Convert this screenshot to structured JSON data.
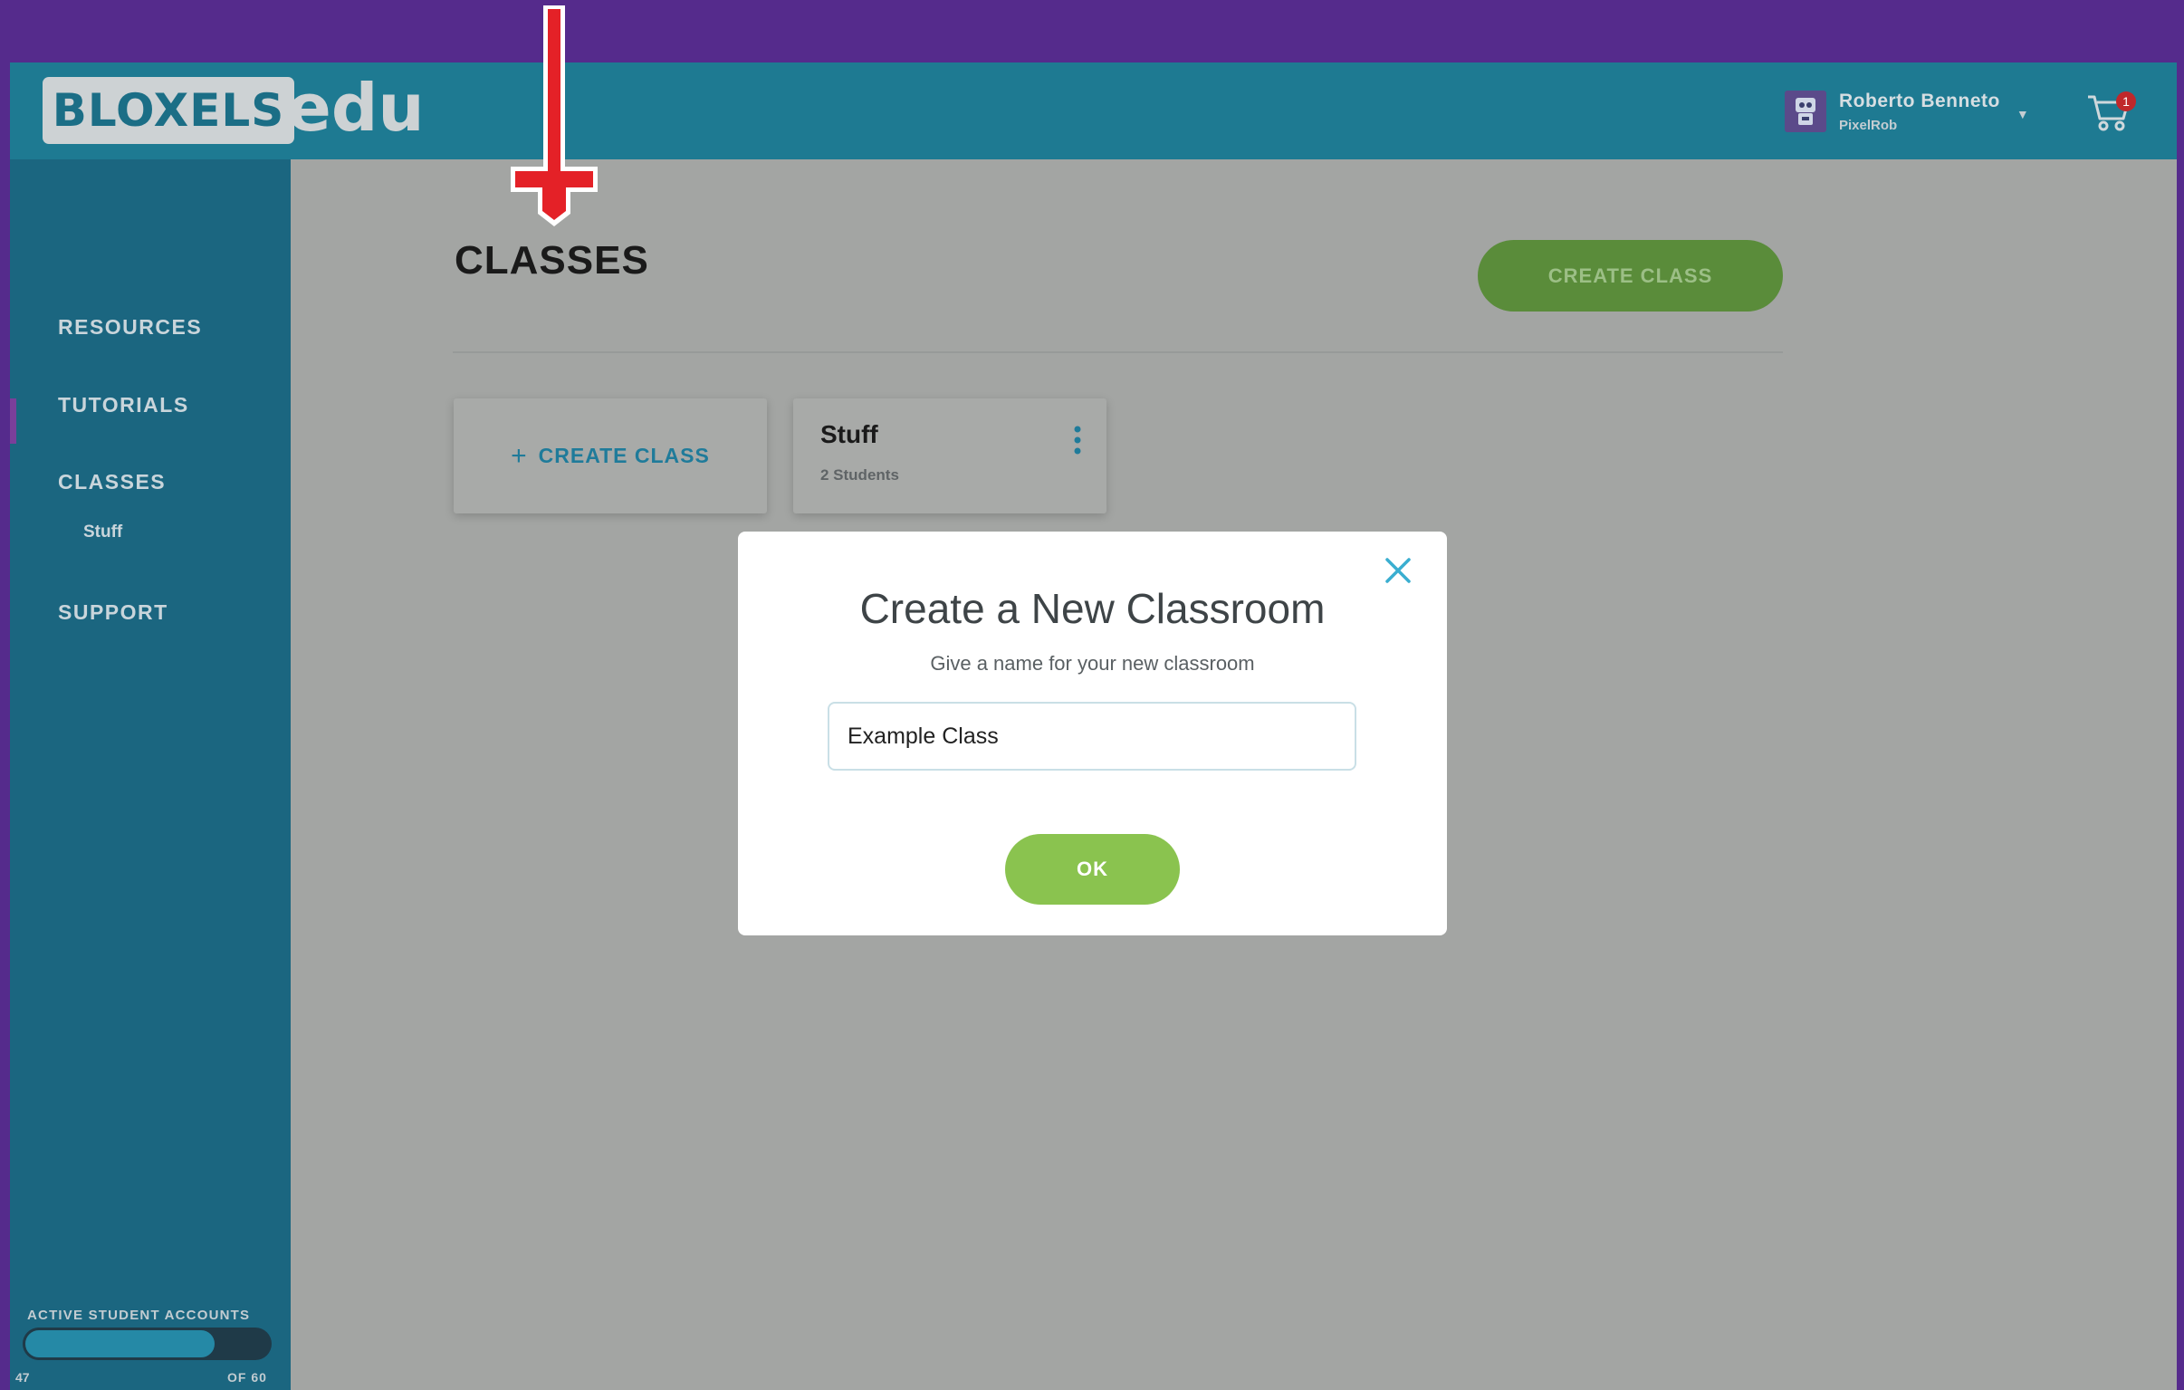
{
  "header": {
    "logo_text": "BLOXELS",
    "logo_suffix": "edu",
    "user_name": "Roberto Benneto",
    "user_handle": "PixelRob",
    "cart_count": "1"
  },
  "sidebar": {
    "items": [
      {
        "label": "RESOURCES"
      },
      {
        "label": "TUTORIALS"
      },
      {
        "label": "CLASSES"
      },
      {
        "label": "Stuff"
      },
      {
        "label": "SUPPORT"
      }
    ],
    "accounts_label": "ACTIVE STUDENT ACCOUNTS",
    "accounts_used": "47",
    "accounts_total": "OF 60",
    "accounts_fraction": 0.78
  },
  "main": {
    "title": "CLASSES",
    "create_button": "CREATE CLASS",
    "create_card_plus": "+",
    "create_card_label": "CREATE CLASS",
    "class_card": {
      "name": "Stuff",
      "count": "2 Students"
    }
  },
  "modal": {
    "title": "Create a New Classroom",
    "subtitle": "Give a name for your new classroom",
    "input_value": "Example Class",
    "ok_label": "OK"
  },
  "colors": {
    "frame": "#552b8c",
    "header": "#1e7a92",
    "sidebar": "#1b6680",
    "accent_green": "#8ac34f",
    "pointer": "#e42127"
  }
}
